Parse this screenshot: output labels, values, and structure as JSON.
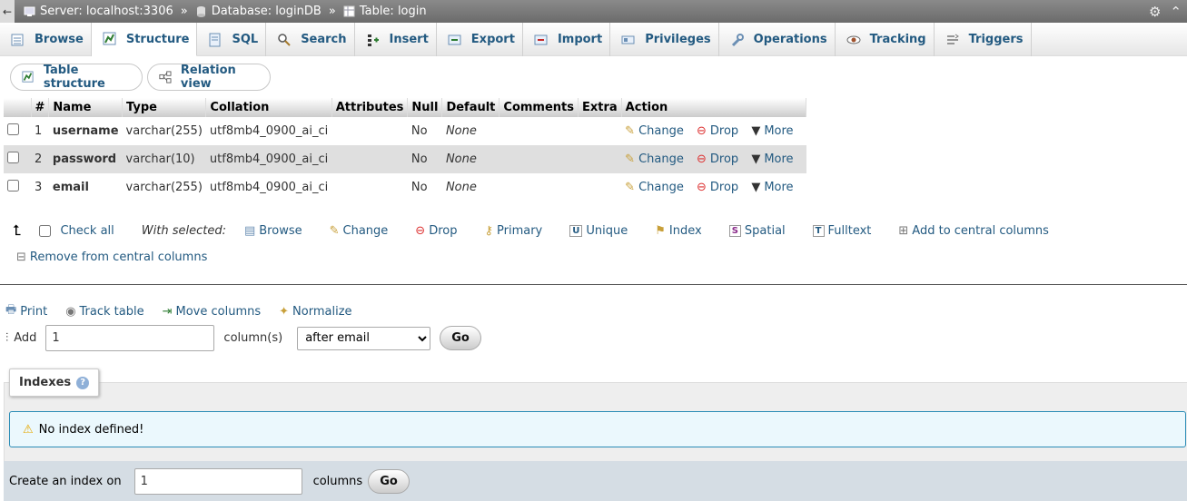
{
  "breadcrumb": {
    "server": "Server: localhost:3306",
    "database": "Database: loginDB",
    "table": "Table: login",
    "separator": "»"
  },
  "tabs": [
    {
      "label": "Browse",
      "icon": "browse-icon"
    },
    {
      "label": "Structure",
      "icon": "structure-icon",
      "active": true
    },
    {
      "label": "SQL",
      "icon": "sql-icon"
    },
    {
      "label": "Search",
      "icon": "search-icon"
    },
    {
      "label": "Insert",
      "icon": "insert-icon"
    },
    {
      "label": "Export",
      "icon": "export-icon"
    },
    {
      "label": "Import",
      "icon": "import-icon"
    },
    {
      "label": "Privileges",
      "icon": "privileges-icon"
    },
    {
      "label": "Operations",
      "icon": "wrench-icon"
    },
    {
      "label": "Tracking",
      "icon": "eye-icon"
    },
    {
      "label": "Triggers",
      "icon": "triggers-icon"
    }
  ],
  "subtabs": {
    "table_structure": "Table structure",
    "relation_view": "Relation view"
  },
  "table": {
    "headers": [
      "#",
      "Name",
      "Type",
      "Collation",
      "Attributes",
      "Null",
      "Default",
      "Comments",
      "Extra",
      "Action"
    ],
    "rows": [
      {
        "num": "1",
        "name": "username",
        "type": "varchar(255)",
        "collation": "utf8mb4_0900_ai_ci",
        "attributes": "",
        "null": "No",
        "default": "None",
        "comments": "",
        "extra": ""
      },
      {
        "num": "2",
        "name": "password",
        "type": "varchar(10)",
        "collation": "utf8mb4_0900_ai_ci",
        "attributes": "",
        "null": "No",
        "default": "None",
        "comments": "",
        "extra": ""
      },
      {
        "num": "3",
        "name": "email",
        "type": "varchar(255)",
        "collation": "utf8mb4_0900_ai_ci",
        "attributes": "",
        "null": "No",
        "default": "None",
        "comments": "",
        "extra": ""
      }
    ],
    "actions": {
      "change": "Change",
      "drop": "Drop",
      "more": "More"
    }
  },
  "with_selected": {
    "check_all": "Check all",
    "label": "With selected:",
    "browse": "Browse",
    "change": "Change",
    "drop": "Drop",
    "primary": "Primary",
    "unique": "Unique",
    "index": "Index",
    "spatial": "Spatial",
    "fulltext": "Fulltext",
    "add_central": "Add to central columns",
    "remove_central": "Remove from central columns"
  },
  "tools": {
    "print": "Print",
    "track": "Track table",
    "move": "Move columns",
    "normalize": "Normalize"
  },
  "add_columns": {
    "label": "Add",
    "value": "1",
    "suffix": "column(s)",
    "position": "after email",
    "go": "Go"
  },
  "indexes": {
    "title": "Indexes",
    "notice": "No index defined!",
    "create_label": "Create an index on",
    "create_value": "1",
    "create_suffix": "columns",
    "go": "Go"
  },
  "colors": {
    "link": "#235a81",
    "notice_border": "#2a8cb6",
    "notice_bg": "#ebf8fd"
  }
}
